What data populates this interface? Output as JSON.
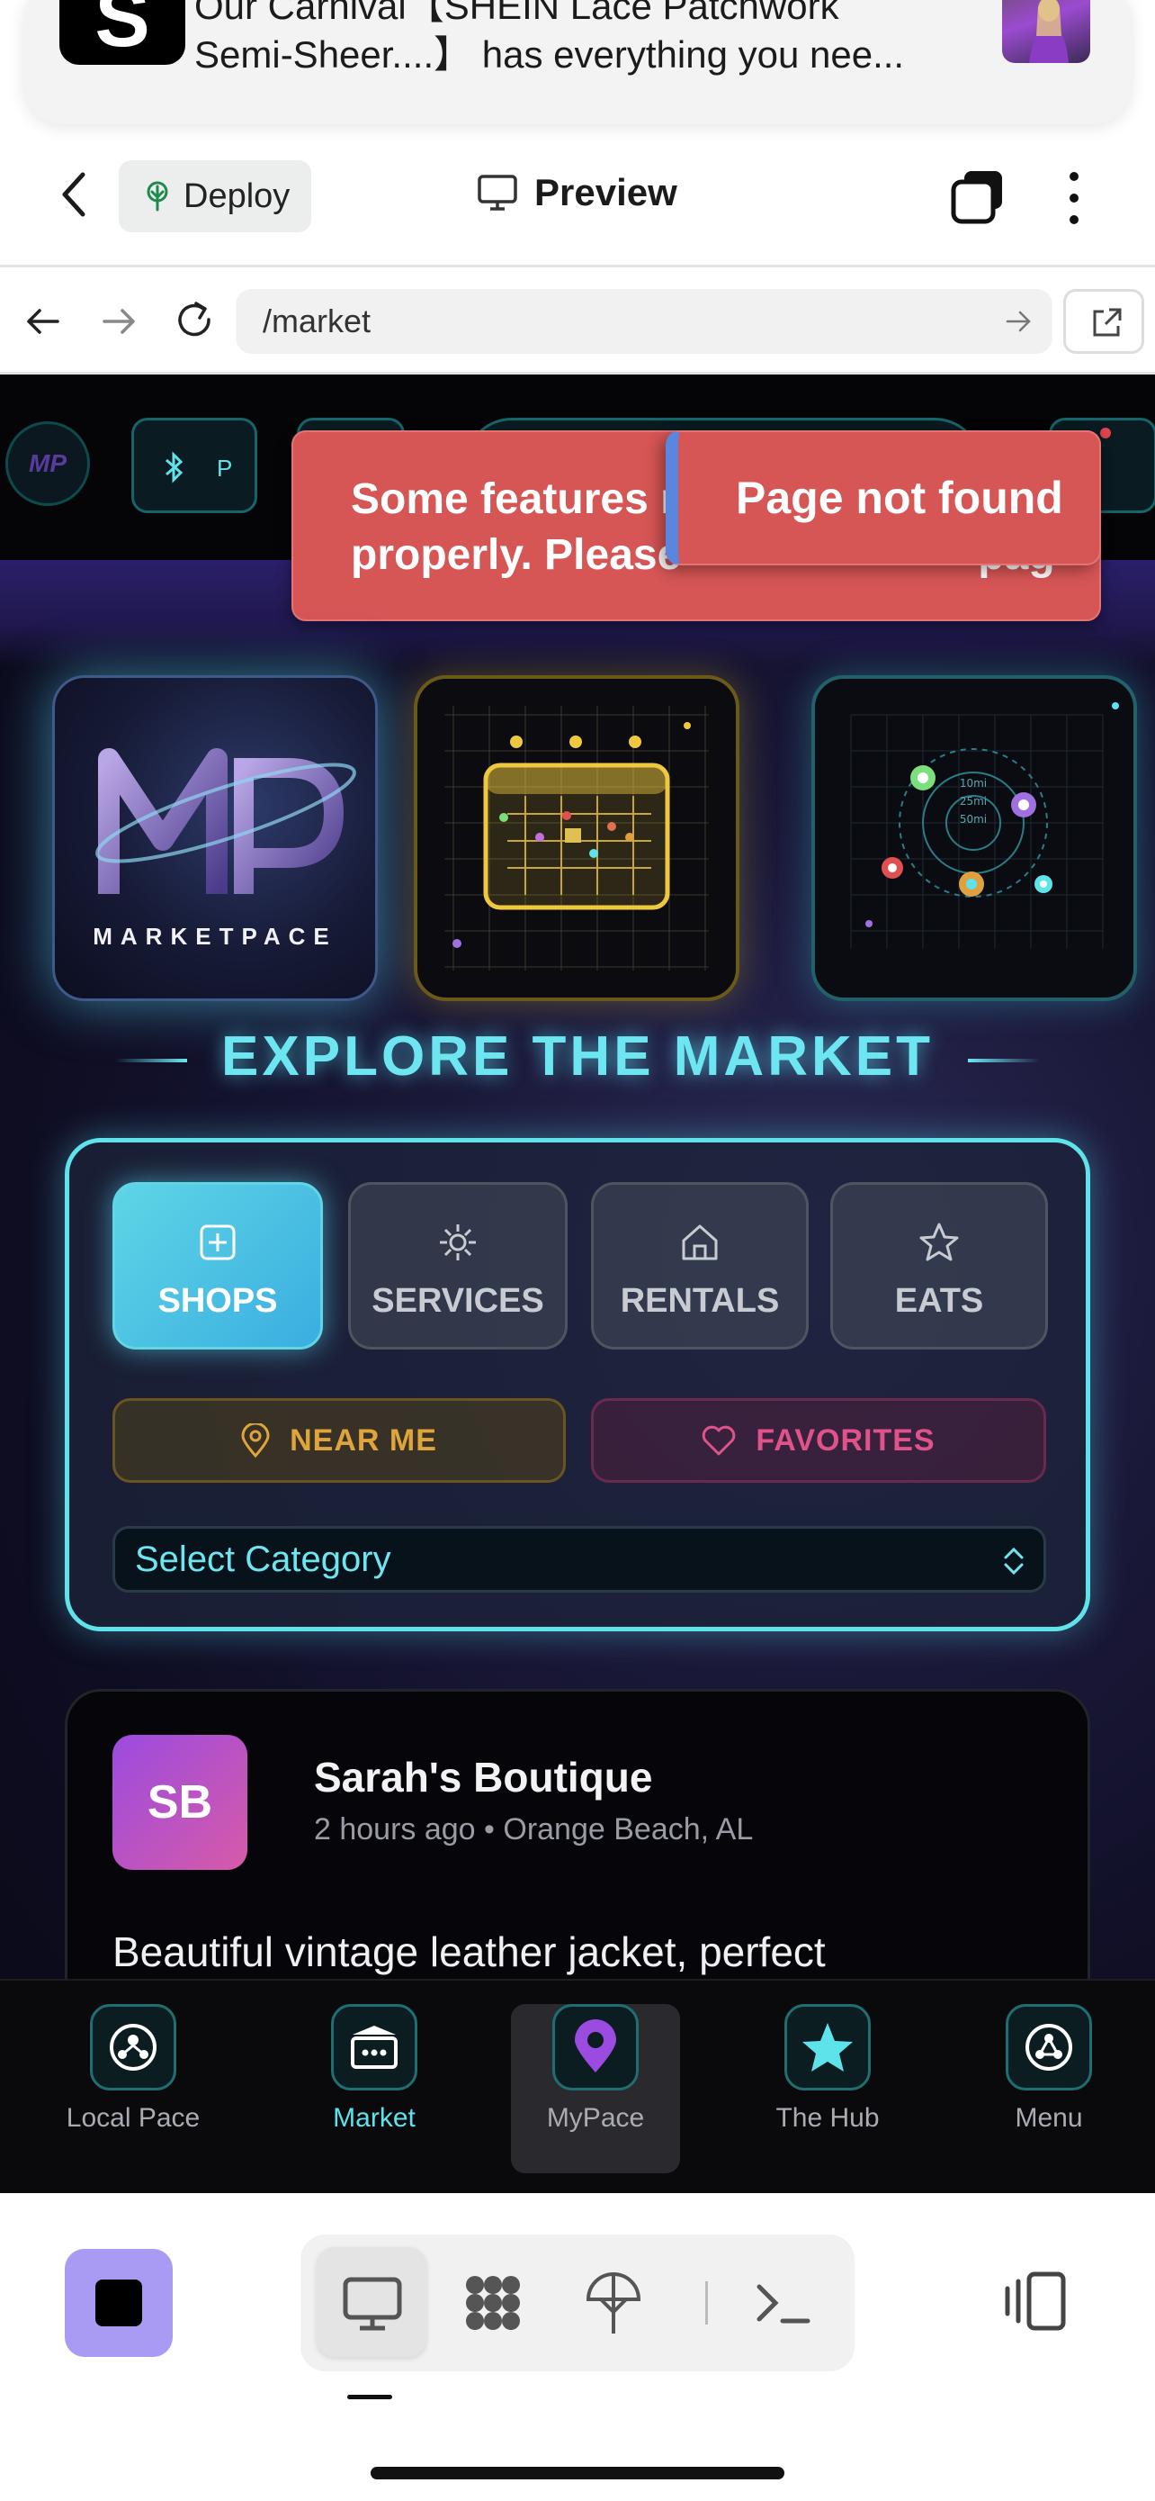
{
  "notification": {
    "logo_letter": "S",
    "text_line1": "Our Carnival【SHEIN Lace Patchwork",
    "text_line2": "Semi-Sheer....】 has everything you nee..."
  },
  "topbar": {
    "deploy_label": "Deploy",
    "preview_label": "Preview"
  },
  "urlbar": {
    "url": "/market"
  },
  "app_header": {
    "avatar_text": "MP",
    "chip_text": "P"
  },
  "toasts": {
    "features_line1": "Some features m",
    "features_line2": "properly. Please",
    "features_tail": "pag",
    "not_found": "Page not found"
  },
  "tiles": {
    "mp_label": "MARKETPACE",
    "radar_rings": [
      "10mi",
      "25mi",
      "50mi"
    ]
  },
  "heading": "EXPLORE THE MARKET",
  "filters": {
    "categories": [
      {
        "label": "SHOPS",
        "icon": "plus-square-icon",
        "active": true
      },
      {
        "label": "SERVICES",
        "icon": "sun-icon",
        "active": false
      },
      {
        "label": "RENTALS",
        "icon": "home-icon",
        "active": false
      },
      {
        "label": "EATS",
        "icon": "star-icon",
        "active": false
      }
    ],
    "near_me": "NEAR ME",
    "favorites": "FAVORITES",
    "select_placeholder": "Select Category"
  },
  "post": {
    "avatar_initials": "SB",
    "name": "Sarah's Boutique",
    "meta": "2 hours ago • Orange Beach, AL",
    "body": "Beautiful vintage leather jacket, perfect"
  },
  "bottom_nav": [
    {
      "label": "Local Pace",
      "icon": "people-icon"
    },
    {
      "label": "Market",
      "icon": "market-icon",
      "active": true
    },
    {
      "label": "MyPace",
      "icon": "location-pin-icon"
    },
    {
      "label": "The Hub",
      "icon": "star-icon"
    },
    {
      "label": "Menu",
      "icon": "network-icon"
    }
  ],
  "colors": {
    "accent_cyan": "#5ee3ea",
    "toast_red": "#d65555",
    "near_me_gold": "#e0a53a",
    "favorites_pink": "#e0528a",
    "stop_purple": "#a99af3"
  }
}
